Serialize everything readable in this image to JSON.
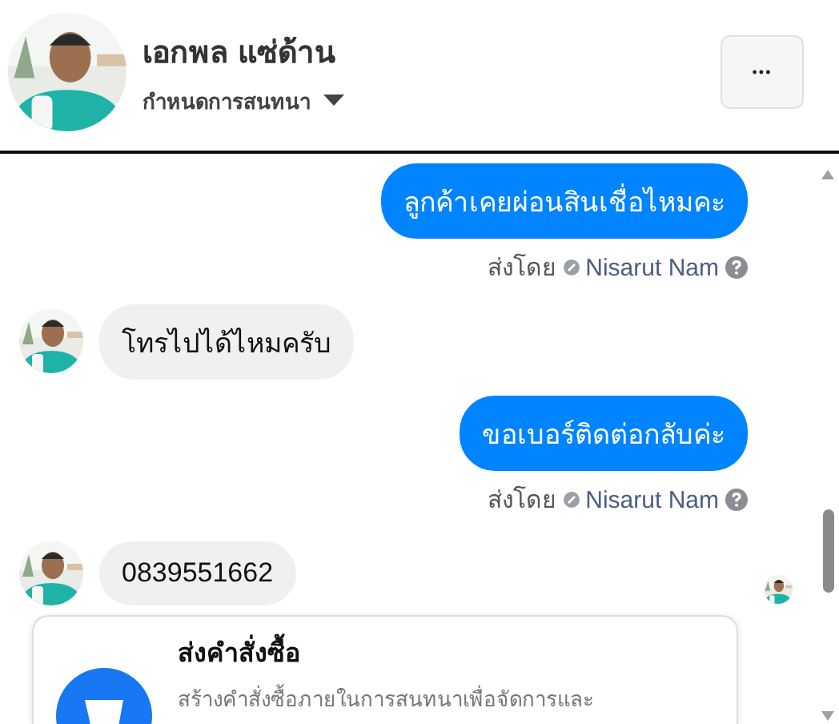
{
  "header": {
    "name": "เอกพล แซ่ด้าน",
    "subtitle": "กำหนดการสนทนา",
    "more_button": "•••"
  },
  "messages": [
    {
      "kind": "outgoing",
      "text": "ลูกค้าเคยผ่อนสินเชื่อไหมคะ",
      "sent_by_label": "ส่งโดย",
      "sender": "Nisarut Nam"
    },
    {
      "kind": "incoming",
      "text": "โทรไปได้ไหมครับ",
      "seen": false
    },
    {
      "kind": "outgoing",
      "text": "ขอเบอร์ติดต่อกลับค่ะ",
      "sent_by_label": "ส่งโดย",
      "sender": "Nisarut Nam"
    },
    {
      "kind": "incoming",
      "text": "0839551662",
      "seen": true
    }
  ],
  "order_card": {
    "title": "ส่งคำสั่งซื้อ",
    "description": "สร้างคำสั่งซื้อภายในการสนทนาเพื่อจัดการและ"
  }
}
